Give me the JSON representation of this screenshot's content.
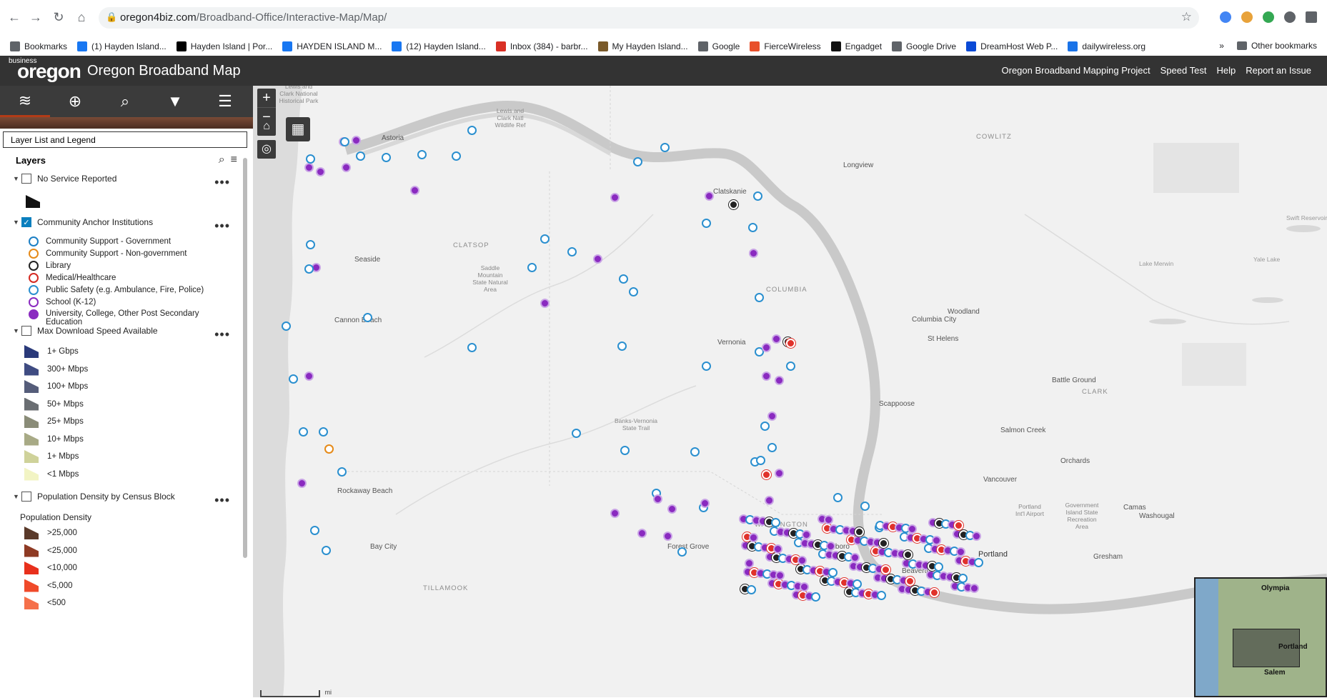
{
  "browser": {
    "url_host": "oregon4biz.com",
    "url_path": "/Broadband-Office/Interactive-Map/Map/"
  },
  "bookmarks": {
    "items": [
      {
        "label": "Bookmarks",
        "icon": "folder-icon",
        "color": "#5f6368"
      },
      {
        "label": "(1) Hayden Island...",
        "icon": "facebook-icon",
        "color": "#1877f2"
      },
      {
        "label": "Hayden Island | Por...",
        "icon": "x-icon",
        "color": "#000000"
      },
      {
        "label": "HAYDEN ISLAND M...",
        "icon": "facebook-icon",
        "color": "#1877f2"
      },
      {
        "label": "(12) Hayden Island...",
        "icon": "facebook-icon",
        "color": "#1877f2"
      },
      {
        "label": "Inbox (384) - barbr...",
        "icon": "gmail-icon",
        "color": "#d93025"
      },
      {
        "label": "My Hayden Island...",
        "icon": "site-icon",
        "color": "#7a5a2a"
      },
      {
        "label": "Google",
        "icon": "globe-icon",
        "color": "#5f6368"
      },
      {
        "label": "FierceWireless",
        "icon": "fw-icon",
        "color": "#e8502b"
      },
      {
        "label": "Engadget",
        "icon": "engadget-icon",
        "color": "#111111"
      },
      {
        "label": "Google Drive",
        "icon": "globe-icon",
        "color": "#5f6368"
      },
      {
        "label": "DreamHost Web P...",
        "icon": "dreamhost-icon",
        "color": "#0a4ad6"
      },
      {
        "label": "dailywireless.org",
        "icon": "wifi-icon",
        "color": "#1a73e8"
      }
    ],
    "more": "»",
    "other": "Other bookmarks"
  },
  "app": {
    "logo_small": "business",
    "logo_big": "oregon",
    "title": "Oregon Broadband Map",
    "links": [
      "Oregon Broadband Mapping Project",
      "Speed Test",
      "Help",
      "Report an Issue"
    ]
  },
  "panel": {
    "title": "Layer List and Legend",
    "layers_label": "Layers",
    "no_service": "No Service Reported",
    "anchor": "Community Anchor Institutions",
    "anchor_items": [
      {
        "label": "Community Support - Government",
        "icon": "government-icon"
      },
      {
        "label": "Community Support - Non-government",
        "icon": "non-government-icon"
      },
      {
        "label": "Library",
        "icon": "library-icon"
      },
      {
        "label": "Medical/Healthcare",
        "icon": "medical-icon"
      },
      {
        "label": "Public Safety (e.g. Ambulance, Fire, Police)",
        "icon": "public-safety-icon"
      },
      {
        "label": "School (K-12)",
        "icon": "school-icon"
      },
      {
        "label": "University, College, Other Post Secondary",
        "label2": "Education",
        "icon": "university-icon"
      }
    ],
    "speed": "Max Download Speed Available",
    "speed_items": [
      {
        "label": "1+ Gbps",
        "color": "#2a3a7a"
      },
      {
        "label": "300+ Mbps",
        "color": "#3f4c82"
      },
      {
        "label": "100+ Mbps",
        "color": "#555d7a"
      },
      {
        "label": "50+ Mbps",
        "color": "#6a6e72"
      },
      {
        "label": "25+ Mbps",
        "color": "#8a8c78"
      },
      {
        "label": "10+ Mbps",
        "color": "#a8aa86"
      },
      {
        "label": "1+ Mbps",
        "color": "#cfd29a"
      },
      {
        "label": "<1 Mbps",
        "color": "#f2f4c4"
      }
    ],
    "density": "Population Density by Census Block",
    "density_sub": "Population Density",
    "density_items": [
      {
        "label": ">25,000",
        "color": "#5a3a2a"
      },
      {
        "label": "<25,000",
        "color": "#8e3a24"
      },
      {
        "label": "<10,000",
        "color": "#e8301c"
      },
      {
        "label": "<5,000",
        "color": "#f04a2a"
      },
      {
        "label": "<500",
        "color": "#f5704a"
      }
    ]
  },
  "map": {
    "labels": {
      "cowlitz": "COWLITZ",
      "longview": "Longview",
      "clatskanie": "Clatskanie",
      "clatsop": "CLATSOP",
      "columbia": "COLUMBIA",
      "woodland": "Woodland",
      "columbia_city": "Columbia City",
      "st_helens": "St Helens",
      "vernonia": "Vernonia",
      "cannon_beach": "Cannon Beach",
      "seaside": "Seaside",
      "astoria": "Astoria",
      "scappoose": "Scappoose",
      "battle_ground": "Battle Ground",
      "clark": "CLARK",
      "salmon_creek": "Salmon Creek",
      "orchards": "Orchards",
      "vancouver": "Vancouver",
      "camas": "Camas",
      "washougal": "Washougal",
      "washington": "WASHINGTON",
      "hillsboro": "Hillsboro",
      "portland": "Portland",
      "gresham": "Gresham",
      "beaverton": "Beaverton",
      "forest_grove": "Forest Grove",
      "rockaway": "Rockaway Beach",
      "bay_city": "Bay City",
      "tillamook": "TILLAMOOK",
      "swift": "Swift Reservoir",
      "yale": "Yale Lake",
      "merwin": "Lake Merwin",
      "lewis_clark": "Lewis and Clark Natl Wildlife Ref",
      "clark_park": "Lewis and Clark National Historical Park",
      "saddle": "Saddle Mountain State Natural Area",
      "banks": "Banks-Vernonia State Trail",
      "gov_island": "Government Island State Recreation Area",
      "portland_airport": "Portland Int'l Airport",
      "scale": "mi"
    },
    "overview": {
      "olympia": "Olympia",
      "portland": "Portland",
      "salem": "Salem"
    }
  }
}
